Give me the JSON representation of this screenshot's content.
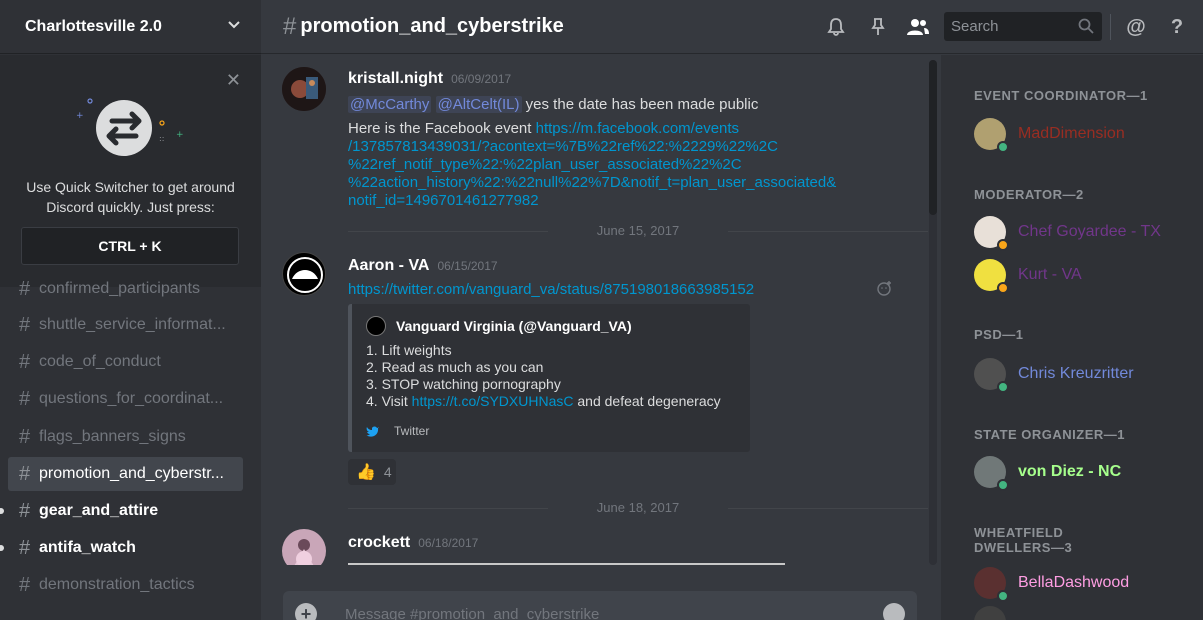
{
  "server": {
    "name": "Charlottesville 2.0"
  },
  "quick_switcher": {
    "text_line1": "Use Quick Switcher to get around",
    "text_line2": "Discord quickly. Just press:",
    "shortcut": "CTRL + K",
    "close_icon": "close-icon"
  },
  "channels": [
    {
      "name": "confirmed_participants",
      "state": "muted"
    },
    {
      "name": "shuttle_service_informat...",
      "state": "muted"
    },
    {
      "name": "code_of_conduct",
      "state": "muted"
    },
    {
      "name": "questions_for_coordinat...",
      "state": "muted"
    },
    {
      "name": "flags_banners_signs",
      "state": "muted"
    },
    {
      "name": "promotion_and_cyberstr...",
      "state": "active"
    },
    {
      "name": "gear_and_attire",
      "state": "unread"
    },
    {
      "name": "antifa_watch",
      "state": "unread"
    },
    {
      "name": "demonstration_tactics",
      "state": "muted"
    }
  ],
  "chat": {
    "hash": "#",
    "title": "promotion_and_cyberstrike",
    "search_placeholder": "Search",
    "composer_placeholder": "Message #promotion_and_cyberstrike"
  },
  "messages": [
    {
      "author": "kristall.night",
      "time": "06/09/2017",
      "mentions": [
        "@McCarthy",
        "@AltCelt(IL)"
      ],
      "text": "yes the date has been made public",
      "line2_prefix": "Here is the Facebook event ",
      "link_lines": [
        "https://m.facebook.com/events",
        "/137857813439031/?acontext=%7B%22ref%22:%2229%22%2C",
        "%22ref_notif_type%22:%22plan_user_associated%22%2C",
        "%22action_history%22:%22null%22%7D&notif_t=plan_user_associated&",
        "notif_id=1496701461277982"
      ]
    },
    {
      "date_separator": "June 15, 2017",
      "author": "Aaron - VA",
      "time": "06/15/2017",
      "link": "https://twitter.com/vanguard_va/status/875198018663985152",
      "embed": {
        "author": "Vanguard Virginia (@Vanguard_VA)",
        "lines": [
          "1. Lift weights",
          "2. Read as much as you can",
          "3. STOP watching pornography"
        ],
        "line4_prefix": "4. Visit ",
        "line4_link": "https://t.co/SYDXUHNasC",
        "line4_suffix": " and defeat degeneracy",
        "footer": "Twitter"
      },
      "reaction": {
        "emoji": "👍",
        "count": "4"
      }
    },
    {
      "date_separator": "June 18, 2017",
      "author": "crockett",
      "time": "06/18/2017"
    }
  ],
  "members": {
    "groups": [
      {
        "role": "EVENT COORDINATOR—1",
        "members": [
          {
            "name": "MadDimension",
            "color": "#992d22",
            "status": "online"
          }
        ]
      },
      {
        "role": "MODERATOR—2",
        "members": [
          {
            "name": "Chef Goyardee - TX",
            "color": "#71368a",
            "status": "idle"
          },
          {
            "name": "Kurt - VA",
            "color": "#71368a",
            "status": "idle"
          }
        ]
      },
      {
        "role": "PSD—1",
        "members": [
          {
            "name": "Chris Kreuzritter",
            "color": "#7289da",
            "status": "online"
          }
        ]
      },
      {
        "role": "STATE ORGANIZER—1",
        "members": [
          {
            "name": "von Diez - NC",
            "color": "#a6ff8c",
            "status": "online"
          }
        ]
      },
      {
        "role_line1": "WHEATFIELD",
        "role_line2": "DWELLERS—3",
        "members": [
          {
            "name": "BellaDashwood",
            "color": "#ff9ee3",
            "status": "online"
          }
        ]
      }
    ]
  },
  "colors": {
    "online": "#43b581",
    "idle": "#faa61a",
    "link": "#0096cf",
    "mention": "#7289da"
  }
}
